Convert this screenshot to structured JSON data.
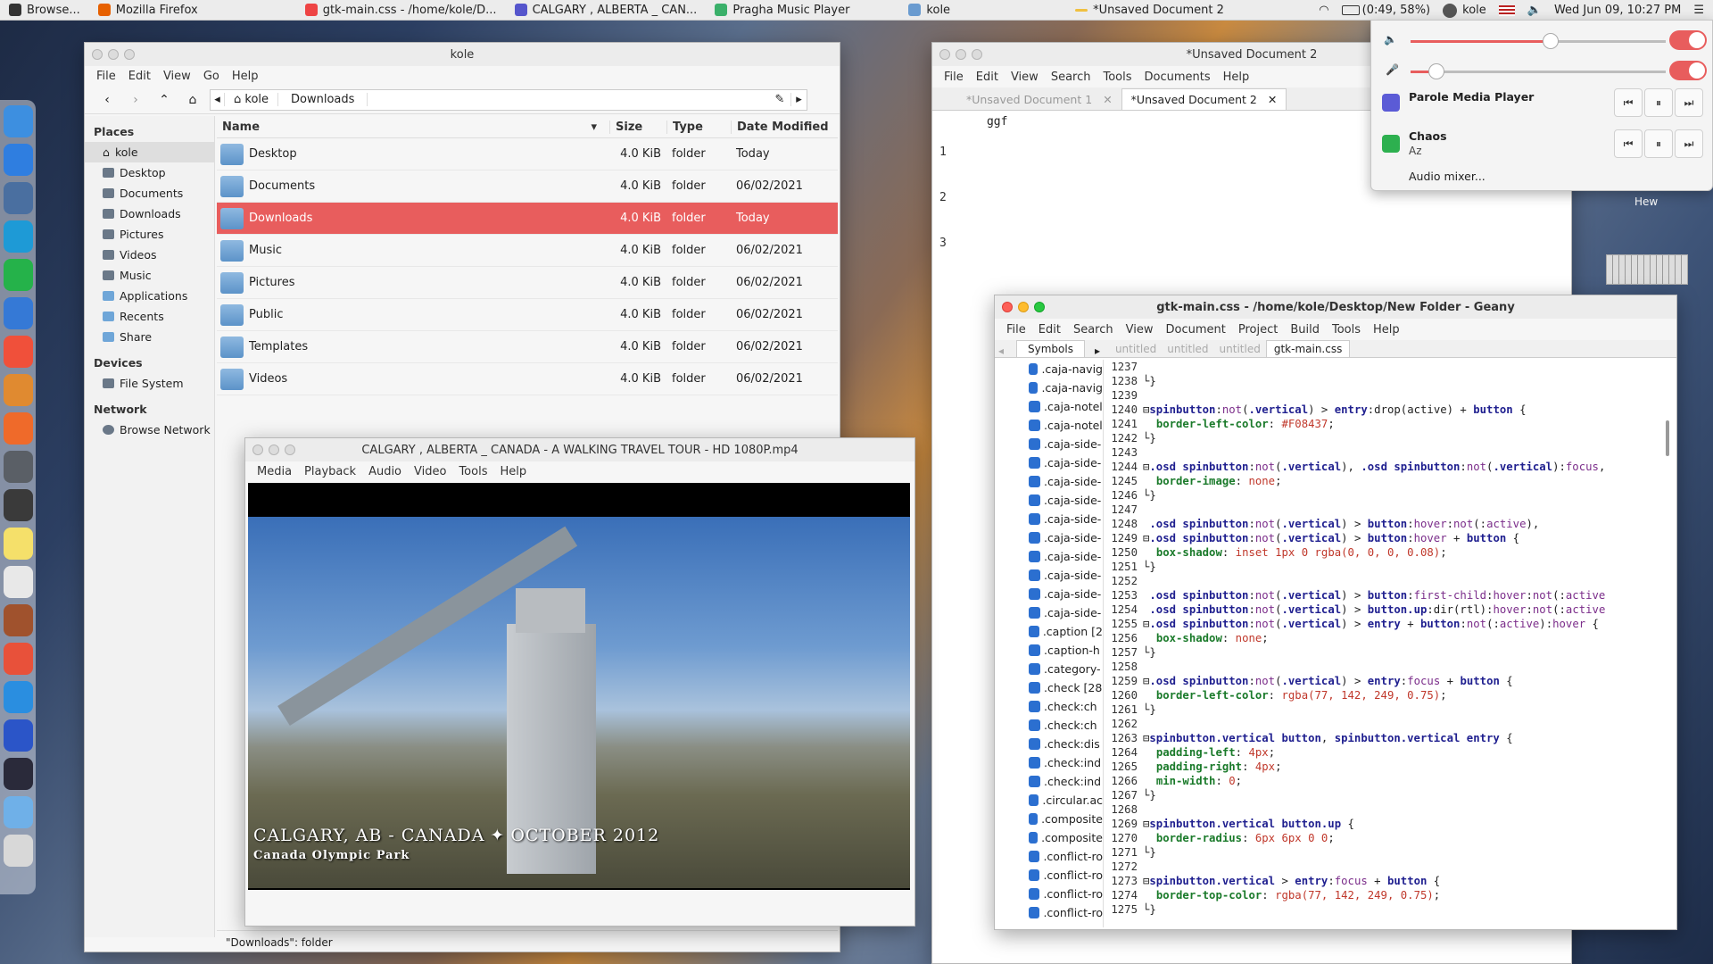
{
  "topbar": {
    "tasks": [
      {
        "label": "Browse...",
        "icon": "app-icon"
      },
      {
        "label": "Mozilla Firefox",
        "icon": "firefox-icon"
      },
      {
        "label": "gtk-main.css - /home/kole/D...",
        "icon": "geany-icon"
      },
      {
        "label": "CALGARY , ALBERTA _ CAN...",
        "icon": "parole-icon"
      },
      {
        "label": "Pragha Music Player",
        "icon": "pragha-icon"
      },
      {
        "label": "kole",
        "icon": "folder-icon"
      },
      {
        "label": "*Unsaved Document 2",
        "icon": "editor-icon"
      }
    ],
    "battery": "(0:49, 58%)",
    "user": "kole",
    "clock": "Wed  Jun 09, 10:27 PM"
  },
  "file_manager": {
    "title": "kole",
    "menu": [
      "File",
      "Edit",
      "View",
      "Go",
      "Help"
    ],
    "path": [
      "kole",
      "Downloads"
    ],
    "places_header": "Places",
    "places": [
      "kole",
      "Desktop",
      "Documents",
      "Downloads",
      "Pictures",
      "Videos",
      "Music",
      "Applications",
      "Recents",
      "Share"
    ],
    "devices_header": "Devices",
    "devices": [
      "File System"
    ],
    "network_header": "Network",
    "network": [
      "Browse Network"
    ],
    "columns": {
      "name": "Name",
      "size": "Size",
      "type": "Type",
      "date": "Date Modified"
    },
    "rows": [
      {
        "name": "Desktop",
        "size": "4.0 KiB",
        "type": "folder",
        "date": "Today"
      },
      {
        "name": "Documents",
        "size": "4.0 KiB",
        "type": "folder",
        "date": "06/02/2021"
      },
      {
        "name": "Downloads",
        "size": "4.0 KiB",
        "type": "folder",
        "date": "Today"
      },
      {
        "name": "Music",
        "size": "4.0 KiB",
        "type": "folder",
        "date": "06/02/2021"
      },
      {
        "name": "Pictures",
        "size": "4.0 KiB",
        "type": "folder",
        "date": "06/02/2021"
      },
      {
        "name": "Public",
        "size": "4.0 KiB",
        "type": "folder",
        "date": "06/02/2021"
      },
      {
        "name": "Templates",
        "size": "4.0 KiB",
        "type": "folder",
        "date": "06/02/2021"
      },
      {
        "name": "Videos",
        "size": "4.0 KiB",
        "type": "folder",
        "date": "06/02/2021"
      }
    ],
    "status": "\"Downloads\": folder"
  },
  "player": {
    "title": "CALGARY , ALBERTA _ CANADA - A WALKING TRAVEL TOUR - HD 1080P.mp4",
    "menu": [
      "Media",
      "Playback",
      "Audio",
      "Video",
      "Tools",
      "Help"
    ],
    "caption_main": "CALGARY, AB - CANADA",
    "caption_date": "OCTOBER 2012",
    "caption_sub": "Canada Olympic Park"
  },
  "mousepad": {
    "title": "*Unsaved Document 2",
    "menu": [
      "File",
      "Edit",
      "View",
      "Search",
      "Tools",
      "Documents",
      "Help"
    ],
    "tabs": [
      "*Unsaved Document 1",
      "*Unsaved Document 2"
    ],
    "lines": [
      "1",
      "2",
      "3"
    ],
    "text": "ggf"
  },
  "geany": {
    "title": "gtk-main.css - /home/kole/Desktop/New Folder - Geany",
    "menu": [
      "File",
      "Edit",
      "Search",
      "View",
      "Document",
      "Project",
      "Build",
      "Tools",
      "Help"
    ],
    "side_tab": "Symbols",
    "tabs": [
      "untitled",
      "untitled",
      "untitled",
      "gtk-main.css"
    ],
    "symbols": [
      ".caja-navig",
      ".caja-navig",
      ".caja-notel",
      ".caja-notel",
      ".caja-side-",
      ".caja-side-",
      ".caja-side-",
      ".caja-side-",
      ".caja-side-",
      ".caja-side-",
      ".caja-side-",
      ".caja-side-",
      ".caja-side-",
      ".caja-side-",
      ".caption [2",
      ".caption-h",
      ".category-",
      ".check [28",
      ".check:ch",
      ".check:ch",
      ".check:dis",
      ".check:ind",
      ".check:ind",
      ".circular.ac",
      ".composite",
      ".composite",
      ".conflict-ro",
      ".conflict-ro",
      ".conflict-ro",
      ".conflict-ro"
    ],
    "line_numbers": [
      "1237",
      "1238",
      "1239",
      "1240",
      "1241",
      "1242",
      "1243",
      "1244",
      "1245",
      "1246",
      "1247",
      "1248",
      "1249",
      "1250",
      "1251",
      "1252",
      "1253",
      "1254",
      "1255",
      "1256",
      "1257",
      "1258",
      "1259",
      "1260",
      "1261",
      "1262",
      "1263",
      "1264",
      "1265",
      "1266",
      "1267",
      "1268",
      "1269",
      "1270",
      "1271",
      "1272",
      "1273",
      "1274",
      "1275"
    ]
  },
  "sound": {
    "player1": "Parole Media Player",
    "player2_title": "Chaos",
    "player2_artist": "Az",
    "mixer": "Audio mixer...",
    "volume": 0.55,
    "mic": 0.1
  },
  "desktop": {
    "label": "Hew"
  }
}
